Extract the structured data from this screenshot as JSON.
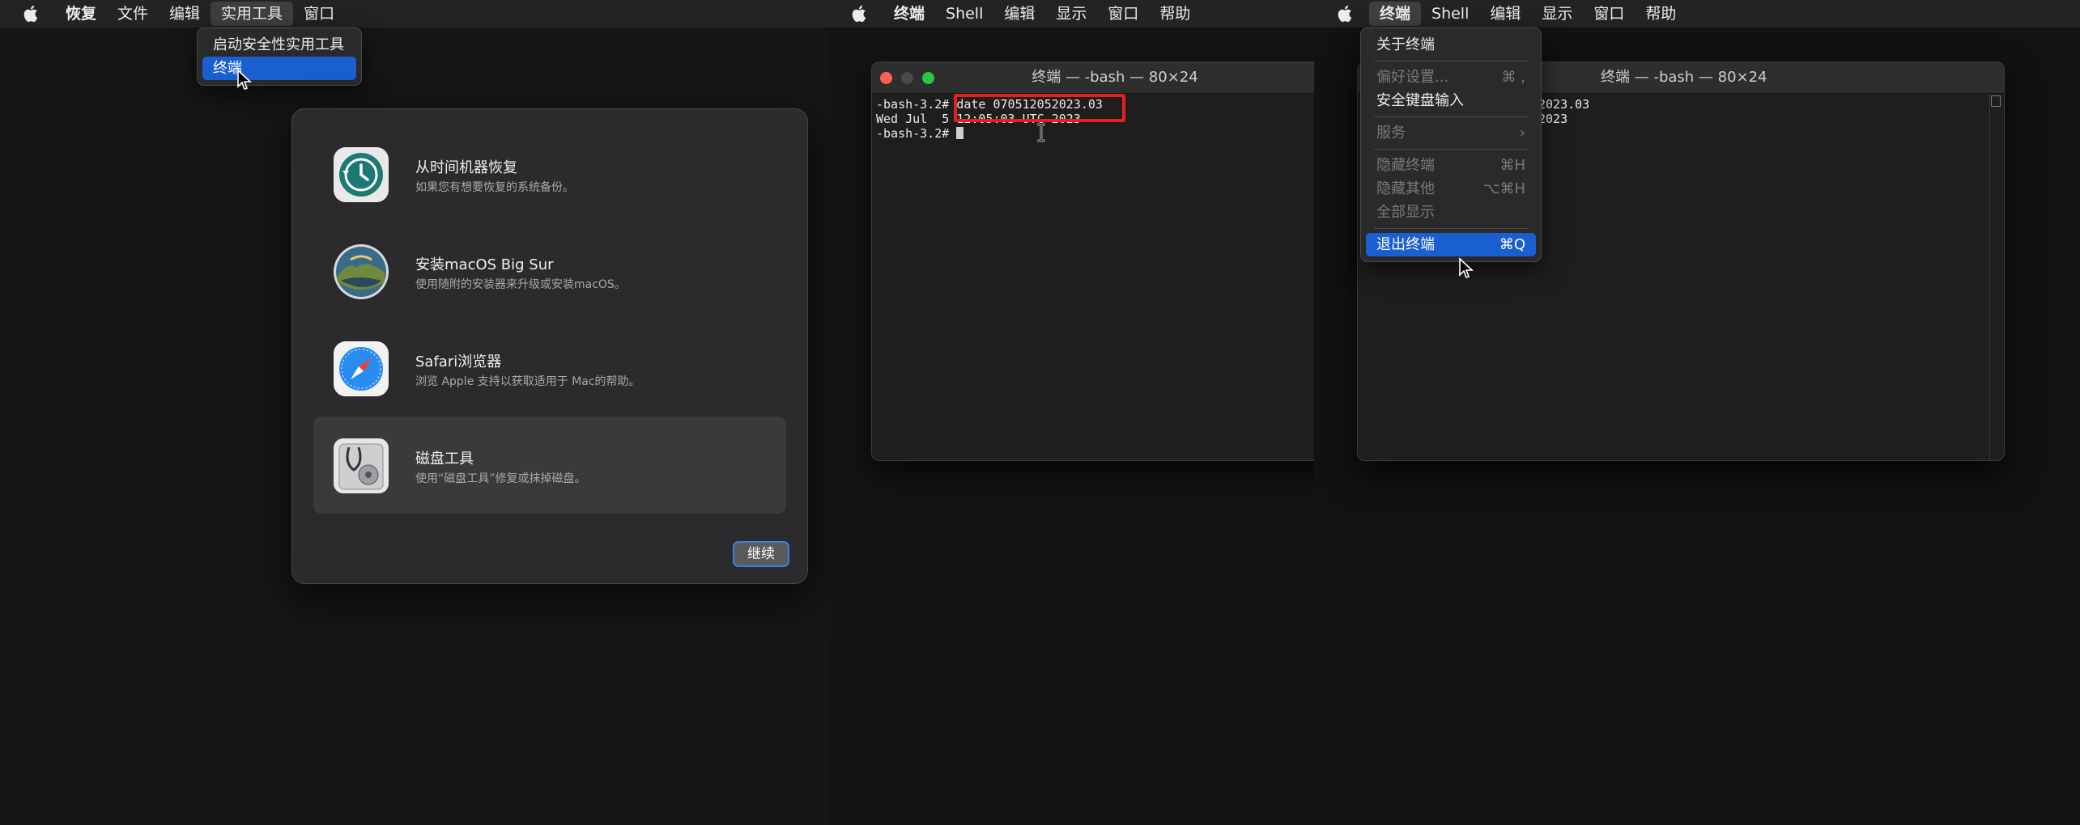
{
  "panel1": {
    "menubar": [
      "恢复",
      "文件",
      "编辑",
      "实用工具",
      "窗口"
    ],
    "utilities_menu": [
      "启动安全性实用工具",
      "终端"
    ],
    "recovery": {
      "options": [
        {
          "title": "从时间机器恢复",
          "desc": "如果您有想要恢复的系统备份。"
        },
        {
          "title": "安装macOS Big Sur",
          "desc": "使用随附的安装器来升级或安装macOS。"
        },
        {
          "title": "Safari浏览器",
          "desc": "浏览 Apple 支持以获取适用于 Mac的帮助。"
        },
        {
          "title": "磁盘工具",
          "desc": "使用“磁盘工具”修复或抹掉磁盘。"
        }
      ],
      "continue_label": "继续"
    }
  },
  "panel2": {
    "menubar": [
      "终端",
      "Shell",
      "编辑",
      "显示",
      "窗口",
      "帮助"
    ],
    "terminal": {
      "title": "终端 — -bash — 80×24",
      "prompt1": "-bash-3.2#",
      "command": "date 070512052023.03",
      "output": "Wed Jul  5 12:05:03 UTC 2023",
      "prompt2": "-bash-3.2#"
    }
  },
  "panel3": {
    "menubar": [
      "终端",
      "Shell",
      "编辑",
      "显示",
      "窗口",
      "帮助"
    ],
    "terminal_menu": [
      {
        "label": "关于终端",
        "shortcut": "",
        "disabled": false
      },
      {
        "label": "偏好设置...",
        "shortcut": "⌘ ,",
        "disabled": true
      },
      {
        "label": "安全键盘输入",
        "shortcut": "",
        "disabled": false
      },
      {
        "label": "服务",
        "shortcut": "›",
        "disabled": true
      },
      {
        "label": "隐藏终端",
        "shortcut": "⌘H",
        "disabled": true
      },
      {
        "label": "隐藏其他",
        "shortcut": "⌥⌘H",
        "disabled": true
      },
      {
        "label": "全部显示",
        "shortcut": "",
        "disabled": true
      },
      {
        "label": "退出终端",
        "shortcut": "⌘Q",
        "disabled": false
      }
    ],
    "terminal": {
      "title": "终端 — -bash — 80×24",
      "line1": "2023.03",
      "line2": "2023"
    }
  },
  "colors": {
    "menubar_bg": "#232323",
    "selection_blue": "#1a5fd0",
    "highlight_red": "#e81f1f",
    "close": "#fe5f57",
    "minimize_inactive": "#4a4a4a",
    "zoom": "#28c840"
  },
  "icons": [
    "apple-icon",
    "time-machine-icon",
    "macos-installer-icon",
    "safari-icon",
    "disk-utility-icon",
    "pointer-cursor-icon",
    "ibeam-cursor-icon"
  ]
}
